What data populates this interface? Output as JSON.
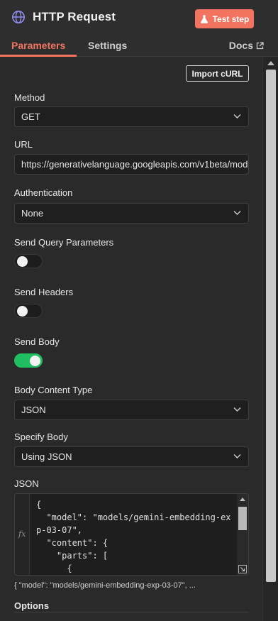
{
  "header": {
    "title": "HTTP Request",
    "test_step_label": "Test step",
    "accent_color": "#f2735f"
  },
  "tabs": {
    "parameters": "Parameters",
    "settings": "Settings",
    "docs": "Docs"
  },
  "import_curl_label": "Import cURL",
  "method": {
    "label": "Method",
    "value": "GET"
  },
  "url": {
    "label": "URL",
    "value": "https://generativelanguage.googleapis.com/v1beta/mode"
  },
  "authentication": {
    "label": "Authentication",
    "value": "None"
  },
  "send_query_parameters": {
    "label": "Send Query Parameters",
    "enabled": false
  },
  "send_headers": {
    "label": "Send Headers",
    "enabled": false
  },
  "send_body": {
    "label": "Send Body",
    "enabled": true,
    "on_color": "#1fbf61"
  },
  "body_content_type": {
    "label": "Body Content Type",
    "value": "JSON"
  },
  "specify_body": {
    "label": "Specify Body",
    "value": "Using JSON"
  },
  "json": {
    "label": "JSON",
    "fx": "fx",
    "lines": [
      "{",
      "  \"model\": \"models/gemini-embedding-ex",
      "p-03-07\",",
      "  \"content\": {",
      "    \"parts\": [",
      "      {"
    ],
    "preview": "{  \"model\": \"models/gemini-embedding-exp-03-07\",   ..."
  },
  "options_label": "Options",
  "icons": {
    "node_icon": "globe-icon",
    "test_icon": "flask-icon",
    "docs_icon": "external-link-icon"
  }
}
